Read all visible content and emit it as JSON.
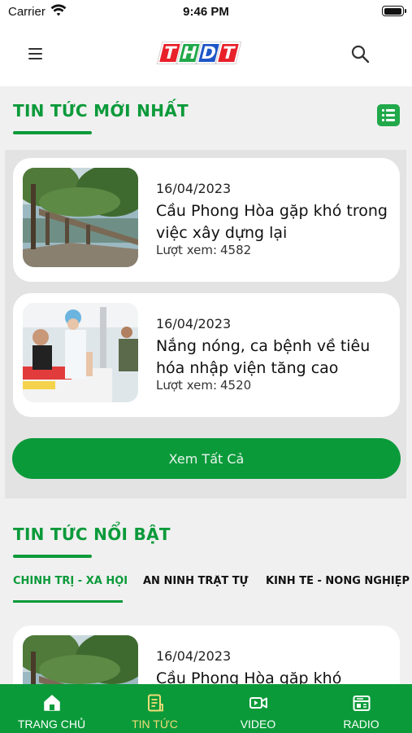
{
  "status_bar": {
    "carrier": "Carrier",
    "time": "9:46 PM",
    "wifi_icon": "wifi-icon",
    "battery_icon": "battery-icon",
    "battery_level": 1.0
  },
  "header": {
    "menu_icon": "hamburger-menu-icon",
    "logo_letters": [
      {
        "char": "T",
        "color": "#e8202a"
      },
      {
        "char": "H",
        "color": "#21a84a"
      },
      {
        "char": "D",
        "color": "#1e56c8"
      },
      {
        "char": "T",
        "color": "#e8202a"
      }
    ],
    "search_icon": "search-icon"
  },
  "latest_news": {
    "title": "TIN TỨC MỚI NHẤT",
    "list_view_icon": "list-view-icon",
    "articles": [
      {
        "date": "16/04/2023",
        "title": "Cầu Phong Hòa gặp khó trong việc xây dựng lại",
        "views_label": "Lượt xem:",
        "views": "4582",
        "thumbnail": "bridge-photo"
      },
      {
        "date": "16/04/2023",
        "title": "Nắng nóng, ca bệnh về tiêu hóa nhập viện tăng cao",
        "views_label": "Lượt xem:",
        "views": "4520",
        "thumbnail": "hospital-photo"
      }
    ],
    "view_all_label": "Xem Tất Cả"
  },
  "featured_news": {
    "title": "TIN TỨC NỔI BẬT",
    "tabs": [
      {
        "label": "CHÍNH TRỊ - XÃ HỘI",
        "active": true
      },
      {
        "label": "AN NINH TRẬT TỰ",
        "active": false
      },
      {
        "label": "KINH TẾ - NÔNG NGHIỆP",
        "active": false
      }
    ],
    "articles": [
      {
        "date": "16/04/2023",
        "title": "Cầu Phong Hòa gặp khó",
        "thumbnail": "bridge-photo"
      }
    ]
  },
  "bottom_nav": {
    "items": [
      {
        "label": "TRANG CHỦ",
        "icon": "home-icon",
        "active": false
      },
      {
        "label": "TIN TỨC",
        "icon": "news-icon",
        "active": true
      },
      {
        "label": "VIDEO",
        "icon": "video-icon",
        "active": false
      },
      {
        "label": "RADIO",
        "icon": "radio-icon",
        "active": false
      }
    ]
  },
  "colors": {
    "brand_green": "#0b9a3a",
    "active_nav": "#f2dc76",
    "panel_bg": "#f0f0f0"
  }
}
